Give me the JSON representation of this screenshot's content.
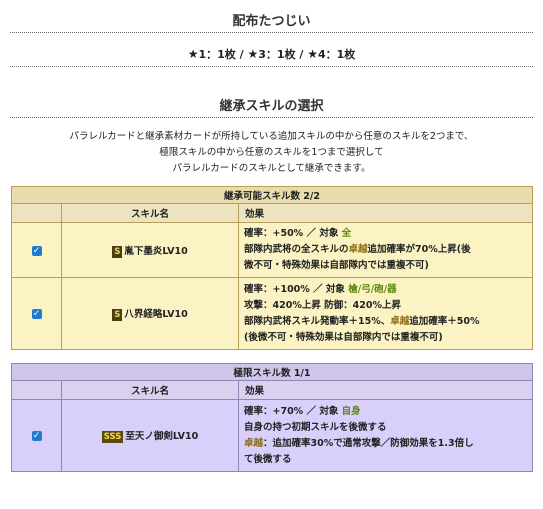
{
  "distribution": {
    "title": "配布たつじい",
    "tiles": [
      {
        "star": "★",
        "text": "1：1枚"
      },
      {
        "star": "★",
        "text": "3：1枚"
      },
      {
        "star": "★",
        "text": "4：1枚"
      }
    ],
    "separator": " / "
  },
  "inherit": {
    "title": "継承スキルの選択",
    "desc": [
      "パラレルカードと継承素材カードが所持している追加スキルの中から任意のスキルを2つまで、",
      "極限スキルの中から任意のスキルを1つまで選択して",
      "パラレルカードのスキルとして継承できます。"
    ]
  },
  "inheritable": {
    "caption": "継承可能スキル数 2/2",
    "col_name": "スキル名",
    "col_effect": "効果",
    "rows": [
      {
        "checked": true,
        "rank": "S",
        "name": "胤下墨炎LV10",
        "l1": {
          "a": "確率：+50% ／ 対象 ",
          "b": "全"
        },
        "l2": {
          "a": "部隊内武将の全スキルの",
          "b": "卓越",
          "c": "追加確率が70%上昇(後"
        },
        "l3": "微不可・特殊効果は自部隊内では重複不可)"
      },
      {
        "checked": true,
        "rank": "S",
        "name": "八界経略LV10",
        "l1": {
          "a": "確率：+100% ／ 対象 ",
          "b": "槍/弓/砲/器"
        },
        "l2": "攻撃：420%上昇 防御：420%上昇",
        "l3": {
          "a": "部隊内武将スキル発動率＋15%、",
          "b": "卓越",
          "c": "追加確率＋50%"
        },
        "l4": "(後微不可・特殊効果は自部隊内では重複不可)"
      }
    ]
  },
  "limit": {
    "caption": "極限スキル数 1/1",
    "col_name": "スキル名",
    "col_effect": "効果",
    "rows": [
      {
        "checked": true,
        "rank": "SSS",
        "name": "至天ノ御剣LV10",
        "l1": {
          "a": "確率：+70% ／ 対象 ",
          "b": "自身"
        },
        "l2": "自身の持つ初期スキルを後微する",
        "l3": {
          "a": "卓越",
          "b": "：追加確率30%で通常攻撃／防御効果を1.3倍し"
        },
        "l4": "て後微する"
      }
    ]
  }
}
